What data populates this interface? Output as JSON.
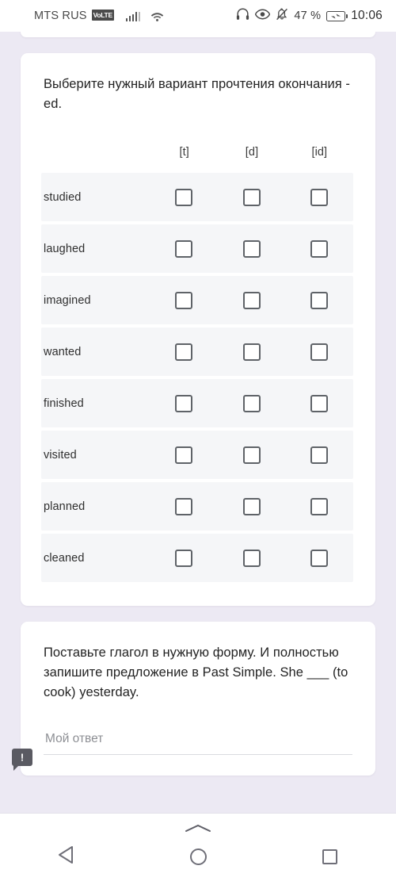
{
  "statusbar": {
    "carrier": "MTS RUS",
    "volte": "VoLTE",
    "signal_icon": "signal-bars-icon",
    "wifi_icon": "wifi-icon",
    "headphones_icon": "headphones-icon",
    "eye_icon": "eye-icon",
    "bell_muted_icon": "bell-muted-icon",
    "battery_percent": "47 %",
    "battery_icon": "battery-charging-icon",
    "clock": "10:06"
  },
  "question1": {
    "text": "Выберите нужный вариант прочтения окончания -ed.",
    "columns": [
      "[t]",
      "[d]",
      "[id]"
    ],
    "rows": [
      {
        "label": "studied",
        "checked": [
          false,
          false,
          false
        ]
      },
      {
        "label": "laughed",
        "checked": [
          false,
          false,
          false
        ]
      },
      {
        "label": "imagined",
        "checked": [
          false,
          false,
          false
        ]
      },
      {
        "label": "wanted",
        "checked": [
          false,
          false,
          false
        ]
      },
      {
        "label": "finished",
        "checked": [
          false,
          false,
          false
        ]
      },
      {
        "label": "visited",
        "checked": [
          false,
          false,
          false
        ]
      },
      {
        "label": "planned",
        "checked": [
          false,
          false,
          false
        ]
      },
      {
        "label": "cleaned",
        "checked": [
          false,
          false,
          false
        ]
      }
    ]
  },
  "question2": {
    "text": "Поставьте глагол в нужную форму. И полностью запишите предложение в Past Simple. She ___ (to cook) yesterday.",
    "answer_value": "",
    "answer_placeholder": "Мой ответ"
  },
  "tooltip_badge": {
    "icon": "alert-tooltip-icon",
    "symbol": "!"
  },
  "navbar": {
    "handle_icon": "chevron-up-handle-icon",
    "back_icon": "back-triangle-icon",
    "home_icon": "home-circle-icon",
    "recents_icon": "recents-square-icon"
  },
  "colors": {
    "page_background": "#ECE9F3",
    "card_background": "#FFFFFF",
    "row_background": "#F5F6F8",
    "checkbox_border": "#5F6368",
    "text_primary": "#232323",
    "text_placeholder": "#8D8F94"
  }
}
